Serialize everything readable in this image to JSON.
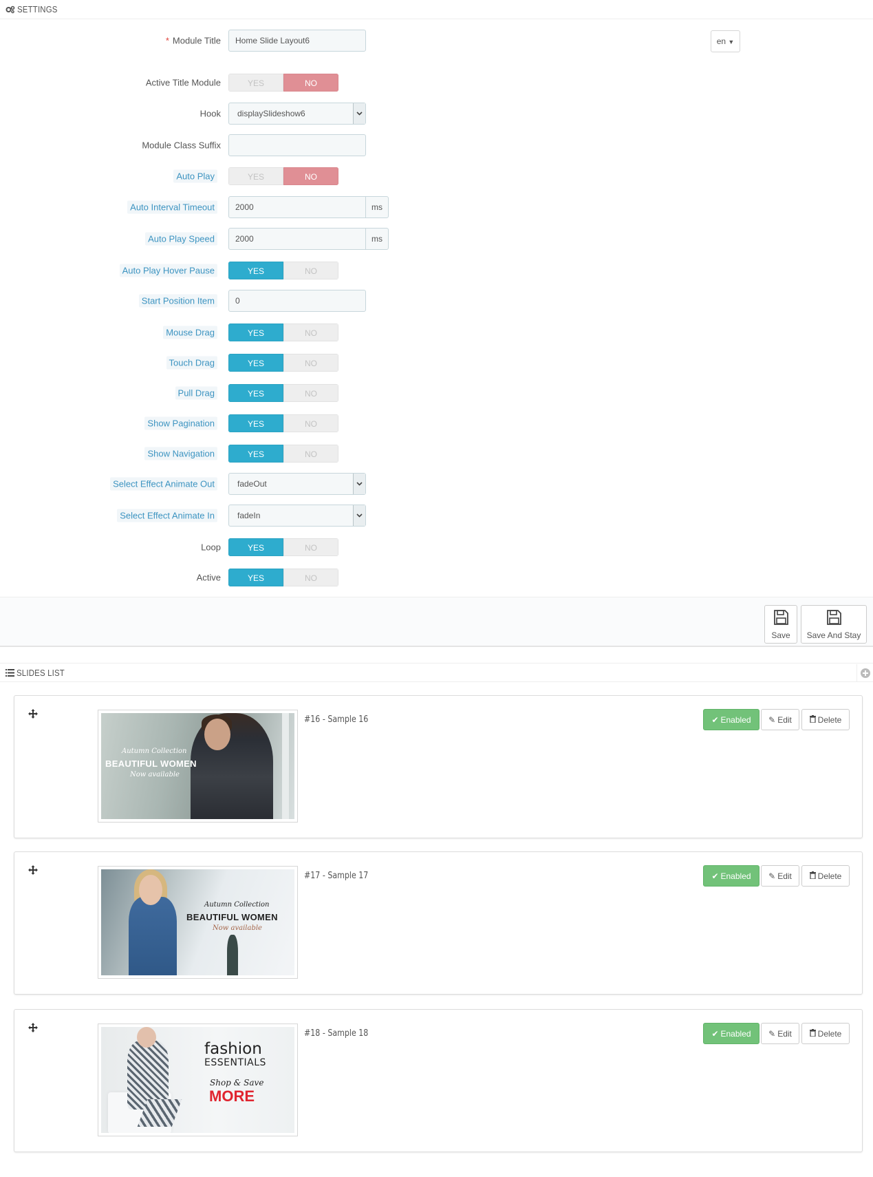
{
  "settings": {
    "header": "SETTINGS",
    "module_title": {
      "label": "Module Title",
      "required_mark": "*",
      "value": "Home Slide Layout6"
    },
    "language": "en",
    "active_title_module": {
      "label": "Active Title Module",
      "yes": "YES",
      "no": "NO",
      "selected": "no"
    },
    "hook": {
      "label": "Hook",
      "value": "displaySlideshow6"
    },
    "module_class_suffix": {
      "label": "Module Class Suffix",
      "value": ""
    },
    "auto_play": {
      "label": "Auto Play",
      "yes": "YES",
      "no": "NO",
      "selected": "no"
    },
    "auto_interval_timeout": {
      "label": "Auto Interval Timeout",
      "value": "2000",
      "unit": "ms"
    },
    "auto_play_speed": {
      "label": "Auto Play Speed",
      "value": "2000",
      "unit": "ms"
    },
    "auto_play_hover_pause": {
      "label": "Auto Play Hover Pause",
      "yes": "YES",
      "no": "NO",
      "selected": "yes"
    },
    "start_position_item": {
      "label": "Start Position Item",
      "value": "0"
    },
    "mouse_drag": {
      "label": "Mouse Drag",
      "yes": "YES",
      "no": "NO",
      "selected": "yes"
    },
    "touch_drag": {
      "label": "Touch Drag",
      "yes": "YES",
      "no": "NO",
      "selected": "yes"
    },
    "pull_drag": {
      "label": "Pull Drag",
      "yes": "YES",
      "no": "NO",
      "selected": "yes"
    },
    "show_pagination": {
      "label": "Show Pagination",
      "yes": "YES",
      "no": "NO",
      "selected": "yes"
    },
    "show_navigation": {
      "label": "Show Navigation",
      "yes": "YES",
      "no": "NO",
      "selected": "yes"
    },
    "effect_out": {
      "label": "Select Effect Animate Out",
      "value": "fadeOut"
    },
    "effect_in": {
      "label": "Select Effect Animate In",
      "value": "fadeIn"
    },
    "loop": {
      "label": "Loop",
      "yes": "YES",
      "no": "NO",
      "selected": "yes"
    },
    "active": {
      "label": "Active",
      "yes": "YES",
      "no": "NO",
      "selected": "yes"
    },
    "save_label": "Save",
    "save_stay_label": "Save And Stay"
  },
  "slides_list": {
    "header": "SLIDES LIST",
    "enabled_label": "Enabled",
    "edit_label": "Edit",
    "delete_label": "Delete",
    "items": [
      {
        "title": "#16 - Sample 16",
        "art": {
          "line1": "Autumn Collection",
          "line2": "BEAUTIFUL WOMEN",
          "line3": "Now available"
        }
      },
      {
        "title": "#17 - Sample 17",
        "art": {
          "line1": "Autumn Collection",
          "line2": "BEAUTIFUL WOMEN",
          "line3": "Now available"
        }
      },
      {
        "title": "#18 - Sample 18",
        "art": {
          "line1": "fashion",
          "line2": "ESSENTIALS",
          "line3": "Shop & Save",
          "line4": "MORE"
        }
      }
    ]
  },
  "colors": {
    "toggle_yes": "#2eacce",
    "toggle_no": "#e08f95",
    "enabled_btn": "#72c279",
    "help_label": "#3d94c1"
  },
  "icons": [
    "gears-icon",
    "chevron-down-icon",
    "save-icon",
    "list-icon",
    "plus-circle-icon",
    "move-icon",
    "check-icon",
    "edit-icon",
    "trash-icon"
  ]
}
